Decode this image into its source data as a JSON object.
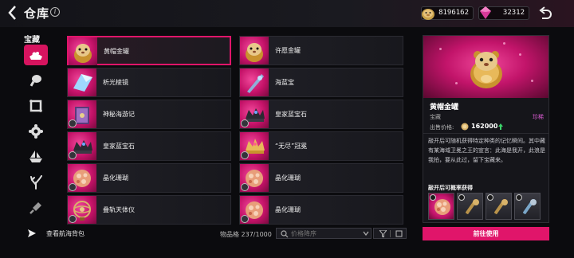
{
  "header": {
    "title": "仓库",
    "currencies": [
      {
        "icon": "hamster-coin-icon",
        "value": "8196162"
      },
      {
        "icon": "pink-gem-icon",
        "value": "32312"
      }
    ]
  },
  "sidebar": {
    "section_title": "宝藏",
    "categories": [
      {
        "icon": "treasure-tray-icon",
        "active": true
      },
      {
        "icon": "drumstick-icon",
        "active": false
      },
      {
        "icon": "frame-icon",
        "active": false
      },
      {
        "icon": "cog-flower-icon",
        "active": false
      },
      {
        "icon": "ship-icon",
        "active": false
      },
      {
        "icon": "coral-icon",
        "active": false
      },
      {
        "icon": "shovel-icon",
        "active": false
      }
    ],
    "footer_label": "查看航海背包"
  },
  "grid": {
    "items": [
      {
        "name": "黄帽金罐",
        "art": "hamster",
        "selected": true,
        "badge": false
      },
      {
        "name": "许愿金罐",
        "art": "hamster",
        "selected": false,
        "badge": false
      },
      {
        "name": "析光棱镜",
        "art": "prism",
        "selected": false,
        "badge": false
      },
      {
        "name": "海蓝宝",
        "art": "blade",
        "selected": false,
        "badge": false
      },
      {
        "name": "神秘海游记",
        "art": "book",
        "selected": false,
        "badge": true
      },
      {
        "name": "皇家蓝宝石",
        "art": "dark-crown",
        "selected": false,
        "badge": true
      },
      {
        "name": "皇家蓝宝石",
        "art": "dark-crown",
        "selected": false,
        "badge": true
      },
      {
        "name": "“无尽”冠冕",
        "art": "crown",
        "selected": false,
        "badge": true
      },
      {
        "name": "晶化珊瑚",
        "art": "coral",
        "selected": false,
        "badge": true
      },
      {
        "name": "晶化珊瑚",
        "art": "coral",
        "selected": false,
        "badge": true
      },
      {
        "name": "叠轨天体仪",
        "art": "globe",
        "selected": false,
        "badge": true
      },
      {
        "name": "晶化珊瑚",
        "art": "coral",
        "selected": false,
        "badge": true
      }
    ],
    "capacity_label": "物品格 237/1000",
    "search_placeholder": "价格降序"
  },
  "detail": {
    "name": "黄帽金罐",
    "type": "宝藏",
    "rarity": "珍稀",
    "price_label": "出售价格:",
    "price": "162000",
    "description": "敲开后可随机获得特定种类的记忆瞬间。其中藏有某海域卫冕之王的宣言：此海是我开，此浪是我拍，要从此过，留下宝藏来。",
    "rewards_title": "敲开后可概率获得",
    "rewards": [
      "coral-reward",
      "tool-reward",
      "tool-reward",
      "tool-reward"
    ],
    "action_label": "前往使用"
  },
  "colors": {
    "accent": "#e0156a",
    "rarity": "#d85bd0"
  }
}
